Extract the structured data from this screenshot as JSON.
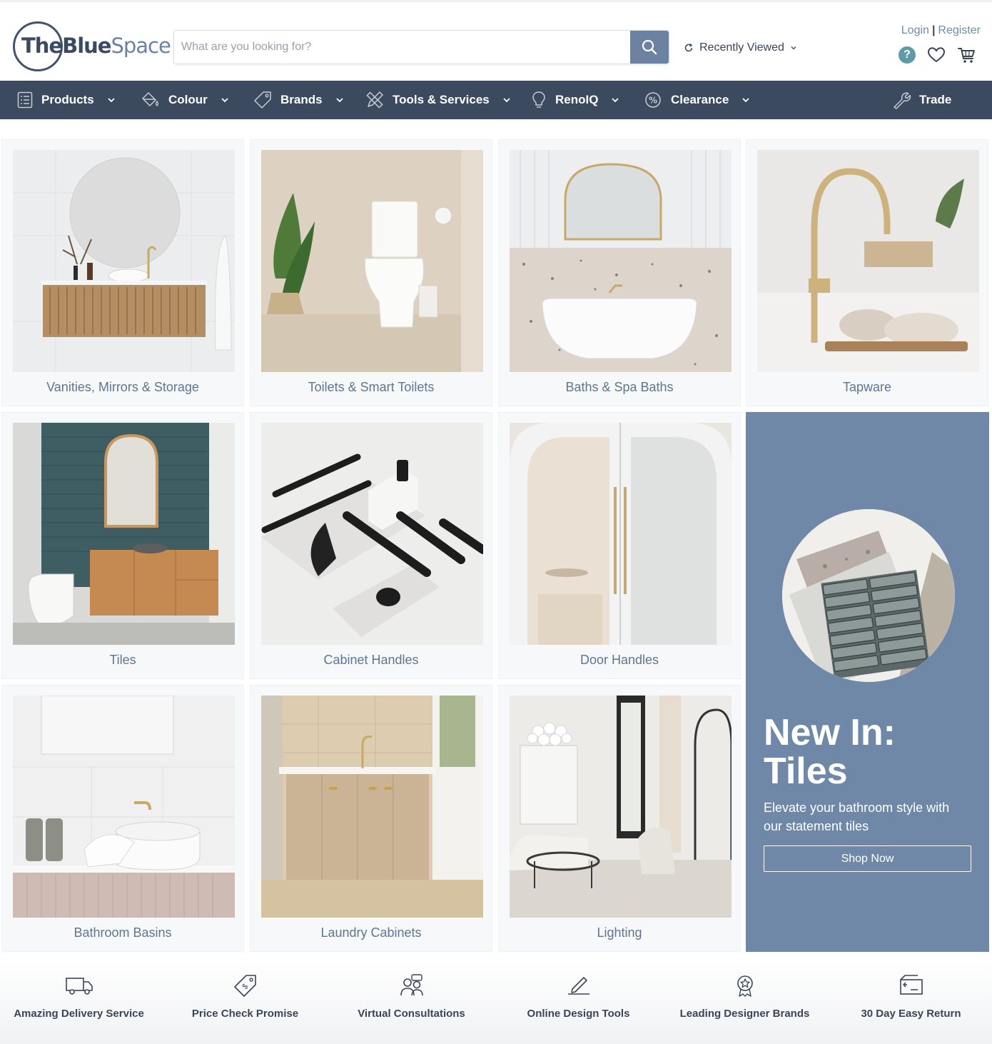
{
  "header": {
    "logo_text_a": "The",
    "logo_text_b": "Blue",
    "logo_text_c": "Space",
    "search_placeholder": "What are you looking for?",
    "recently_viewed": "Recently Viewed",
    "login": "Login",
    "separator": "|",
    "register": "Register",
    "help_glyph": "?"
  },
  "nav": {
    "items": [
      {
        "label": "Products",
        "icon": "list-icon"
      },
      {
        "label": "Colour",
        "icon": "paint-bucket-icon"
      },
      {
        "label": "Brands",
        "icon": "tag-icon"
      },
      {
        "label": "Tools & Services",
        "icon": "ruler-pencil-icon"
      },
      {
        "label": "RenoIQ",
        "icon": "lightbulb-icon"
      },
      {
        "label": "Clearance",
        "icon": "sale-tag-icon"
      }
    ],
    "trade": "Trade"
  },
  "categories": [
    {
      "label": "Vanities, Mirrors & Storage"
    },
    {
      "label": "Toilets & Smart Toilets"
    },
    {
      "label": "Baths & Spa Baths"
    },
    {
      "label": "Tapware"
    },
    {
      "label": "Tiles"
    },
    {
      "label": "Cabinet Handles"
    },
    {
      "label": "Door Handles"
    },
    {
      "label": "Bathroom Basins"
    },
    {
      "label": "Laundry Cabinets"
    },
    {
      "label": "Lighting"
    }
  ],
  "promo": {
    "title_line1": "New In:",
    "title_line2": "Tiles",
    "subtitle": "Elevate your bathroom style with our statement tiles",
    "button": "Shop Now"
  },
  "features": [
    {
      "label": "Amazing Delivery Service",
      "icon": "delivery-truck-icon"
    },
    {
      "label": "Price Check Promise",
      "icon": "price-tag-icon"
    },
    {
      "label": "Virtual Consultations",
      "icon": "consultation-icon"
    },
    {
      "label": "Online Design Tools",
      "icon": "design-pen-icon"
    },
    {
      "label": "Leading Designer Brands",
      "icon": "award-badge-icon"
    },
    {
      "label": "30 Day Easy Return",
      "icon": "return-box-icon"
    }
  ],
  "colors": {
    "nav_bg": "#3c4a5f",
    "accent": "#6f88a8",
    "label_text": "#5f7590",
    "link": "#6d8ca6"
  }
}
